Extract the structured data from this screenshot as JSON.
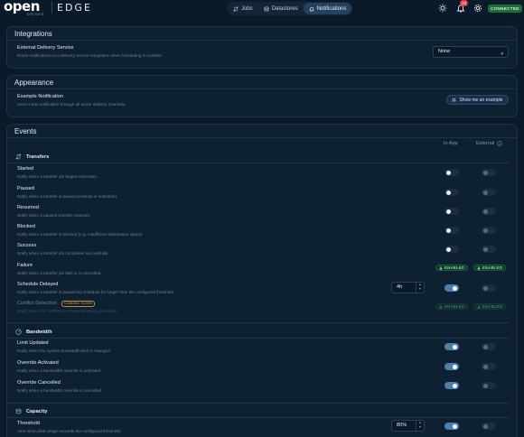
{
  "app": {
    "logo_word": "open",
    "logo_sub": "DRIVES",
    "product": "EDGE",
    "status": "CONNECTED",
    "notification_count": "23"
  },
  "nav": {
    "tabs": [
      {
        "label": "Jobs",
        "icon": "jobs-icon",
        "active": false
      },
      {
        "label": "Datastores",
        "icon": "datastores-icon",
        "active": false
      },
      {
        "label": "Notifications",
        "icon": "bell-icon",
        "active": true
      }
    ]
  },
  "integrations": {
    "title": "Integrations",
    "external": {
      "title": "External Delivery Service",
      "desc": "Route notifications to a delivery service integration when forwarding is enabled.",
      "value": "None"
    }
  },
  "appearance": {
    "title": "Appearance",
    "example": {
      "title": "Example Notification",
      "desc": "Send a test notification through all active delivery channels.",
      "button": "Show me an example"
    }
  },
  "events": {
    "title": "Events",
    "col_in_app": "In App",
    "col_external": "External",
    "transfers": {
      "title": "Transfers",
      "rows": [
        {
          "title": "Started",
          "desc": "Notify when a transfer job begins execution."
        },
        {
          "title": "Paused",
          "desc": "Notify when a transfer is paused (manual or schedule)."
        },
        {
          "title": "Resumed",
          "desc": "Notify when a paused transfer resumes."
        },
        {
          "title": "Blocked",
          "desc": "Notify when a transfer is blocked (e.g. insufficient destination space)."
        },
        {
          "title": "Success",
          "desc": "Notify when a transfer job completes successfully."
        },
        {
          "title": "Failure",
          "desc": "Notify when a transfer job fails or is cancelled.",
          "in_app": "ENABLED",
          "external": "ENABLED"
        },
        {
          "title": "Schedule Delayed",
          "desc": "Notify when a transfer is paused by schedule for longer than the configured threshold.",
          "threshold": "4h"
        },
        {
          "title": "Conflict Detection",
          "desc": "Notify when file conflicts are detected during a transfer.",
          "badge": "COMING SOON",
          "in_app": "ENABLED",
          "external": "ENABLED"
        }
      ]
    },
    "bandwidth": {
      "title": "Bandwidth",
      "rows": [
        {
          "title": "Limit Updated",
          "desc": "Notify when the system bandwidth limit is changed."
        },
        {
          "title": "Override Activated",
          "desc": "Notify when a bandwidth override is activated."
        },
        {
          "title": "Override Cancelled",
          "desc": "Notify when a bandwidth override is cancelled."
        }
      ]
    },
    "capacity": {
      "title": "Capacity",
      "rows": [
        {
          "title": "Threshold",
          "desc": "Alert when disk usage exceeds the configured threshold.",
          "threshold": "80%"
        }
      ]
    }
  },
  "colors": {
    "background": "#0b1a28",
    "panel": "#0e2132",
    "accent": "#4d7fa8",
    "enabled": "#7fdca6",
    "connected": "#1f6b3b"
  }
}
